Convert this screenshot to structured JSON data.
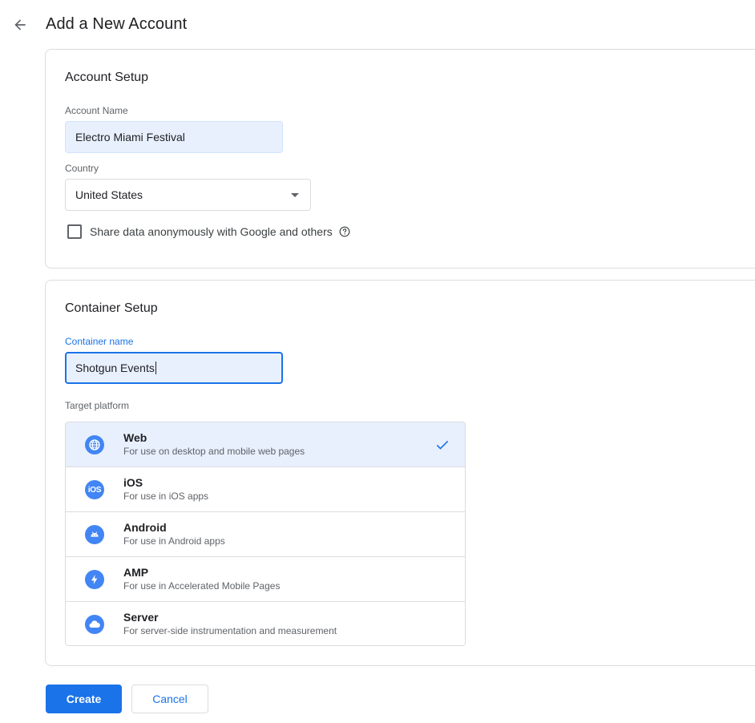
{
  "header": {
    "title": "Add a New Account",
    "back_icon": "arrow-back-icon"
  },
  "account_setup": {
    "title": "Account Setup",
    "account_name_label": "Account Name",
    "account_name_value": "Electro Miami Festival",
    "country_label": "Country",
    "country_value": "United States",
    "share_data_label": "Share data anonymously with Google and others",
    "share_data_checked": false
  },
  "container_setup": {
    "title": "Container Setup",
    "container_name_label": "Container name",
    "container_name_value": "Shotgun Events",
    "target_platform_label": "Target platform",
    "platforms": [
      {
        "name": "Web",
        "description": "For use on desktop and mobile web pages",
        "icon": "globe-icon",
        "selected": true
      },
      {
        "name": "iOS",
        "description": "For use in iOS apps",
        "icon": "ios-icon",
        "selected": false
      },
      {
        "name": "Android",
        "description": "For use in Android apps",
        "icon": "android-icon",
        "selected": false
      },
      {
        "name": "AMP",
        "description": "For use in Accelerated Mobile Pages",
        "icon": "bolt-icon",
        "selected": false
      },
      {
        "name": "Server",
        "description": "For server-side instrumentation and measurement",
        "icon": "cloud-icon",
        "selected": false
      }
    ]
  },
  "actions": {
    "create_label": "Create",
    "cancel_label": "Cancel"
  },
  "colors": {
    "accent": "#1a73e8",
    "selected_bg": "#e8f0fe",
    "icon_bg": "#4285f4"
  }
}
